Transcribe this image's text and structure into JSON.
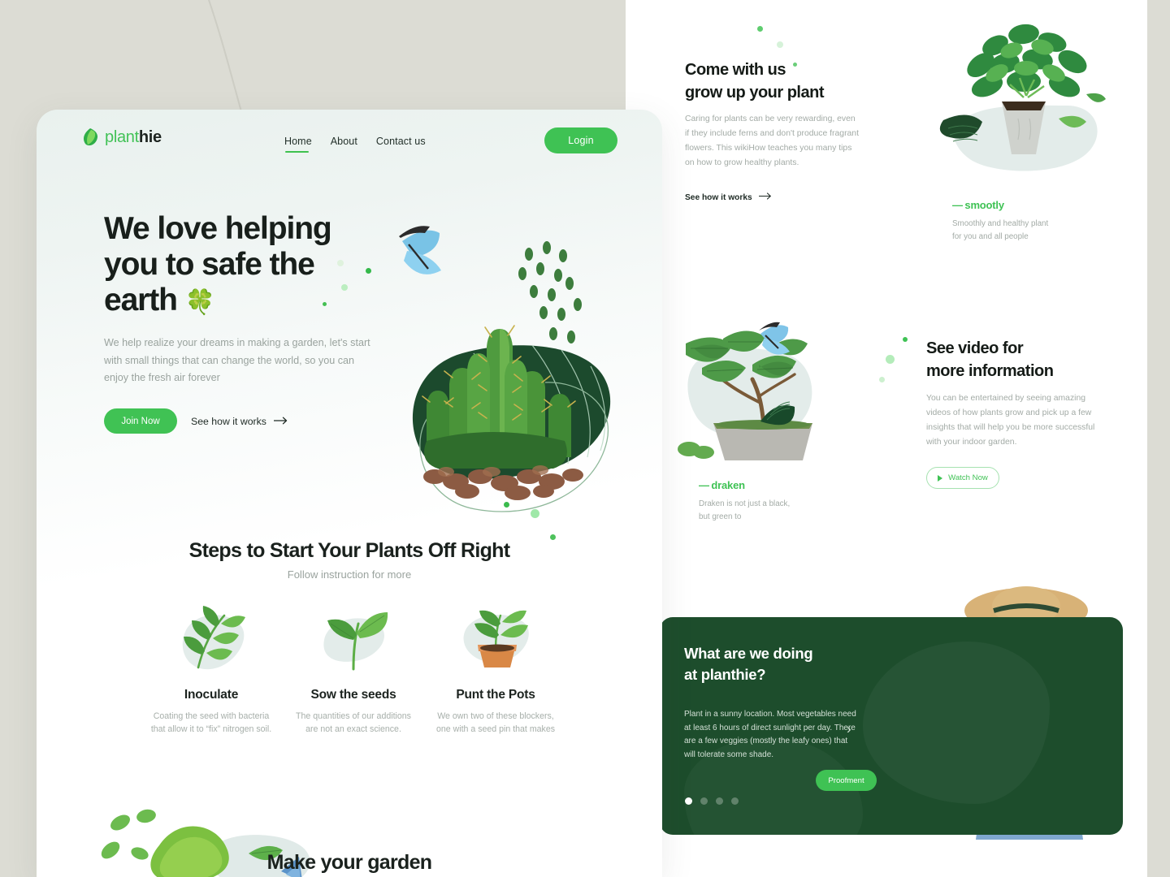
{
  "brand": {
    "name_green": "plant",
    "name_dark": "hie",
    "logo_icon": "leaf-icon",
    "accent": "#3fc254",
    "dark_green": "#1d4d2c"
  },
  "nav": {
    "items": [
      {
        "label": "Home",
        "active": true
      },
      {
        "label": "About",
        "active": false
      },
      {
        "label": "Contact us",
        "active": false
      }
    ],
    "login_label": "Login"
  },
  "hero": {
    "title_line1": "We love helping",
    "title_line2": "you to safe the",
    "title_line3": "earth",
    "title_emoji": "🍀",
    "paragraph": "We help realize your dreams in making a garden, let's start with small things that can change the world, so you can enjoy the fresh air forever",
    "primary_button": "Join Now",
    "secondary_link": "See how it works",
    "arrow_icon": "arrow-right-icon",
    "image_alt": "cactus-illustration"
  },
  "steps": {
    "title": "Steps to Start Your Plants Off Right",
    "subtitle": "Follow instruction for more",
    "items": [
      {
        "icon": "leaf-branch-icon",
        "name": "Inoculate",
        "desc": "Coating the seed with bacteria that allow it to “fix” nitrogen soil."
      },
      {
        "icon": "sprout-icon",
        "name": "Sow the seeds",
        "desc": "The quantities of our additions are not an exact science."
      },
      {
        "icon": "potted-plant-icon",
        "name": "Punt the Pots",
        "desc": "We own two of these blockers, one with a seed pin that makes"
      }
    ]
  },
  "make_garden": {
    "title": "Make your garden",
    "image_alt": "tree-illustration"
  },
  "grow_section": {
    "title_line1": "Come with us",
    "title_line2": "grow up your plant",
    "paragraph": "Caring for plants can be very rewarding, even if they include ferns and don't produce fragrant flowers. This wikiHow teaches you many tips on how to grow healthy plants.",
    "link": "See how it works",
    "arrow_icon": "arrow-right-icon",
    "image_alt": "basil-pot-illustration"
  },
  "caption_smootly": {
    "dash": "—",
    "title": "smootly",
    "line1": "Smoothly and healthy plant",
    "line2": "for you and all people"
  },
  "caption_draken": {
    "dash": "—",
    "title": "draken",
    "line1": "Draken is not just a black,",
    "line2": "but green to"
  },
  "video_section": {
    "title_line1": "See video for",
    "title_line2": "more information",
    "paragraph": "You can be entertained by seeing amazing videos of how plants grow and pick up a few insights that will help you be more successful with your indoor garden.",
    "button": "Watch Now",
    "play_icon": "play-icon",
    "image_alt": "bonsai-pot-illustration"
  },
  "promo": {
    "title_line1": "What are we doing",
    "title_line2": "at planthie?",
    "paragraph": "Plant in a sunny location. Most vegetables need at least 6 hours of direct sunlight per day. There are a few veggies (mostly the leafy ones) that will tolerate some shade.",
    "button": "Proofment",
    "next_icon": "chevron-right-icon",
    "dots_total": 4,
    "dot_active_index": 0,
    "image_alt": "gardener-man-photo"
  }
}
